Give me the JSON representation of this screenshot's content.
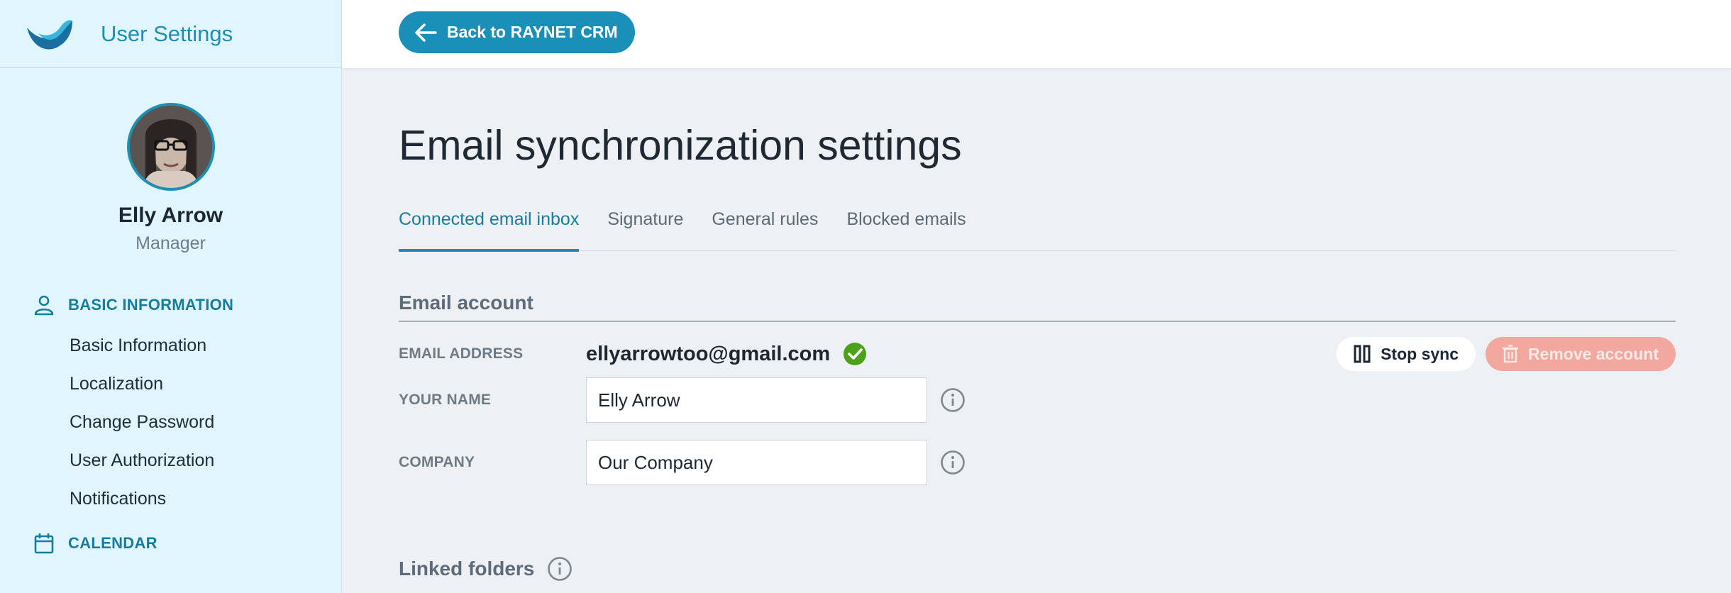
{
  "app": {
    "title": "User Settings"
  },
  "profile": {
    "name": "Elly Arrow",
    "role": "Manager"
  },
  "sidebar": {
    "basic_section": "BASIC INFORMATION",
    "items": [
      "Basic Information",
      "Localization",
      "Change Password",
      "User Authorization",
      "Notifications"
    ],
    "calendar_section": "CALENDAR"
  },
  "topbar": {
    "back_label": "Back to RAYNET CRM"
  },
  "page": {
    "title": "Email synchronization settings"
  },
  "tabs": [
    "Connected email inbox",
    "Signature",
    "General rules",
    "Blocked emails"
  ],
  "account": {
    "section_title": "Email account",
    "email_label": "EMAIL ADDRESS",
    "email_value": "ellyarrowtoo@gmail.com",
    "stop_sync_label": "Stop sync",
    "remove_label": "Remove account",
    "name_label": "YOUR NAME",
    "name_value": "Elly Arrow",
    "company_label": "COMPANY",
    "company_value": "Our Company"
  },
  "linked": {
    "title": "Linked folders"
  },
  "colors": {
    "accent": "#1a8fb8",
    "success": "#4ca11a",
    "danger": "#f2a89e",
    "sidebar_bg": "#e1f5fc"
  }
}
